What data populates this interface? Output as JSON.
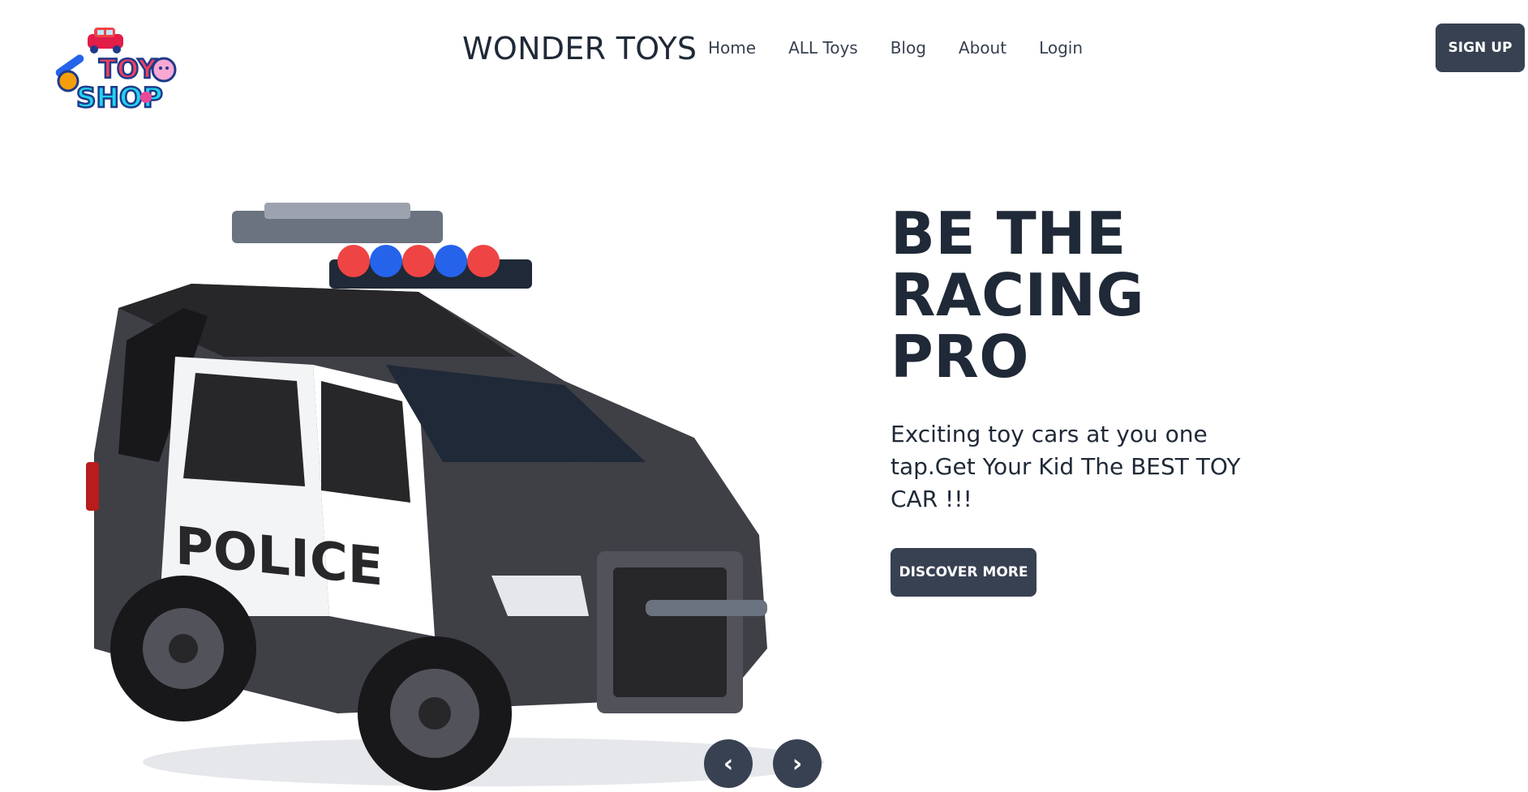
{
  "header": {
    "brand": "WONDER TOYS",
    "logo_icon": "toy-shop-logo",
    "nav": [
      {
        "label": "Home"
      },
      {
        "label": "ALL Toys"
      },
      {
        "label": "Blog"
      },
      {
        "label": "About"
      },
      {
        "label": "Login"
      }
    ],
    "signup_label": "SIGN UP"
  },
  "hero": {
    "title": "BE THE RACING PRO",
    "description": "Exciting toy cars at you one tap.Get Your Kid The BEST TOY CAR !!!",
    "cta_label": "DISCOVER MORE",
    "image_icon": "police-car-image",
    "prev_symbol": "‹",
    "next_symbol": "›"
  },
  "colors": {
    "button_bg": "#374151",
    "text_dark": "#1f2937"
  }
}
